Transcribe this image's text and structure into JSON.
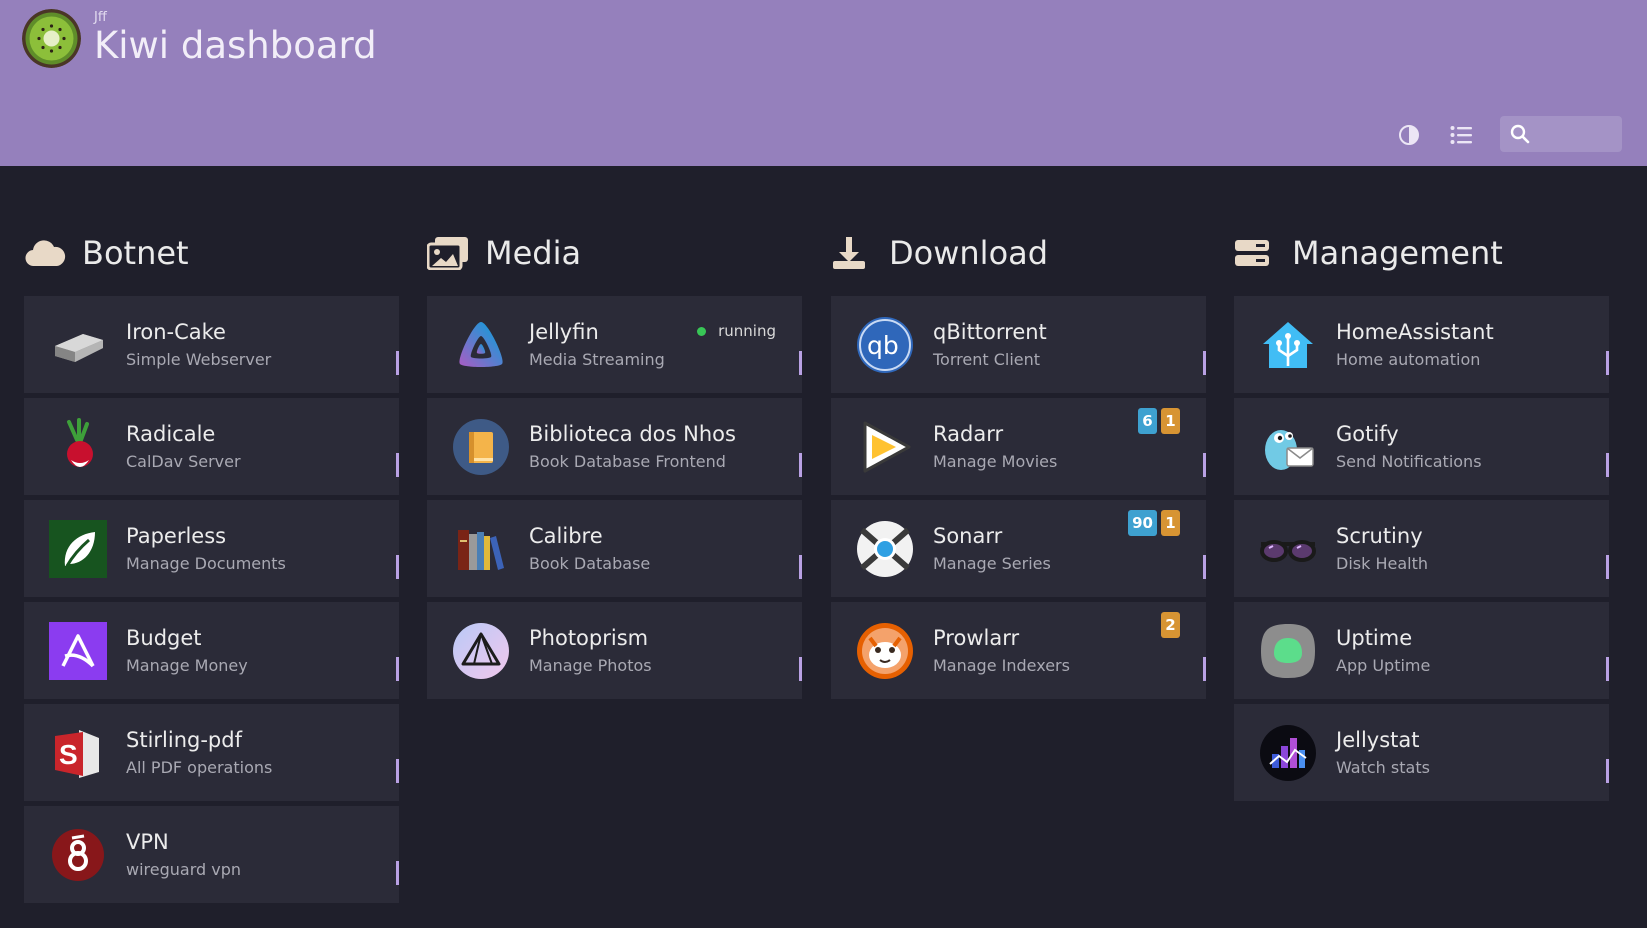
{
  "header": {
    "subtitle": "Jff",
    "title": "Kiwi dashboard",
    "search_placeholder": ""
  },
  "colors": {
    "header_bg": "#9580bc",
    "page_bg": "#1f1f2b",
    "card_bg": "#2b2b38",
    "accent": "#b9a1e4",
    "status_running": "#38c656",
    "badge_blue": "#3ea1d0",
    "badge_orange": "#d79433"
  },
  "groups": [
    {
      "name": "Botnet",
      "icon": "cloud-icon",
      "items": [
        {
          "name": "Iron-Cake",
          "subtitle": "Simple Webserver",
          "icon": "iron-ingot-icon"
        },
        {
          "name": "Radicale",
          "subtitle": "CalDav Server",
          "icon": "radish-icon"
        },
        {
          "name": "Paperless",
          "subtitle": "Manage Documents",
          "icon": "leaf-icon"
        },
        {
          "name": "Budget",
          "subtitle": "Manage Money",
          "icon": "actual-budget-icon"
        },
        {
          "name": "Stirling-pdf",
          "subtitle": "All PDF operations",
          "icon": "stirling-pdf-icon"
        },
        {
          "name": "VPN",
          "subtitle": "wireguard vpn",
          "icon": "wireguard-icon"
        }
      ]
    },
    {
      "name": "Media",
      "icon": "images-icon",
      "items": [
        {
          "name": "Jellyfin",
          "subtitle": "Media Streaming",
          "icon": "jellyfin-icon",
          "status": "running"
        },
        {
          "name": "Biblioteca dos Nhos",
          "subtitle": "Book Database Frontend",
          "icon": "book-icon"
        },
        {
          "name": "Calibre",
          "subtitle": "Book Database",
          "icon": "calibre-books-icon"
        },
        {
          "name": "Photoprism",
          "subtitle": "Manage Photos",
          "icon": "photoprism-icon"
        }
      ]
    },
    {
      "name": "Download",
      "icon": "download-icon",
      "items": [
        {
          "name": "qBittorrent",
          "subtitle": "Torrent Client",
          "icon": "qbittorrent-icon"
        },
        {
          "name": "Radarr",
          "subtitle": "Manage Movies",
          "icon": "radarr-icon",
          "badges": [
            "6",
            "1"
          ]
        },
        {
          "name": "Sonarr",
          "subtitle": "Manage Series",
          "icon": "sonarr-icon",
          "badges": [
            "90",
            "1"
          ]
        },
        {
          "name": "Prowlarr",
          "subtitle": "Manage Indexers",
          "icon": "prowlarr-icon",
          "badges": [
            "2"
          ]
        }
      ]
    },
    {
      "name": "Management",
      "icon": "server-icon",
      "items": [
        {
          "name": "HomeAssistant",
          "subtitle": "Home automation",
          "icon": "home-assistant-icon"
        },
        {
          "name": "Gotify",
          "subtitle": "Send Notifications",
          "icon": "gotify-icon"
        },
        {
          "name": "Scrutiny",
          "subtitle": "Disk Health",
          "icon": "glasses-icon"
        },
        {
          "name": "Uptime",
          "subtitle": "App Uptime",
          "icon": "uptime-kuma-icon"
        },
        {
          "name": "Jellystat",
          "subtitle": "Watch stats",
          "icon": "jellystat-icon"
        }
      ]
    }
  ]
}
